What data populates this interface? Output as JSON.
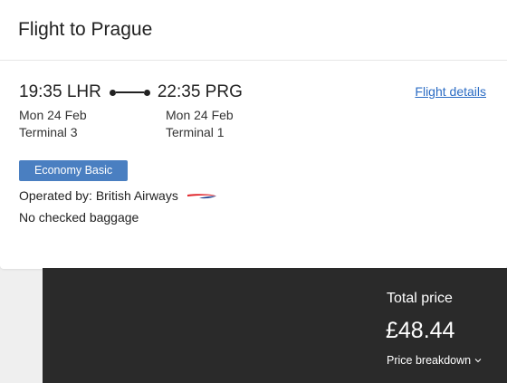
{
  "card": {
    "title": "Flight to Prague"
  },
  "flight": {
    "departure": {
      "time_airport": "19:35 LHR",
      "date": "Mon 24 Feb",
      "terminal": "Terminal 3"
    },
    "arrival": {
      "time_airport": "22:35 PRG",
      "date": "Mon 24 Feb",
      "terminal": "Terminal 1"
    },
    "details_link": "Flight details",
    "fare_badge": "Economy Basic",
    "operated_by": "Operated by: British Airways",
    "airline_logo_icon": "british-airways-speedmarque-icon",
    "baggage": "No checked baggage"
  },
  "price": {
    "label": "Total price",
    "value": "£48.44",
    "breakdown": "Price breakdown",
    "breakdown_icon": "chevron-down-icon"
  },
  "colors": {
    "link": "#2b6cc4",
    "badge": "#4a7fc1",
    "panel": "#2a2a2a",
    "logo_red": "#e0252b",
    "logo_blue": "#1a3a8a"
  }
}
